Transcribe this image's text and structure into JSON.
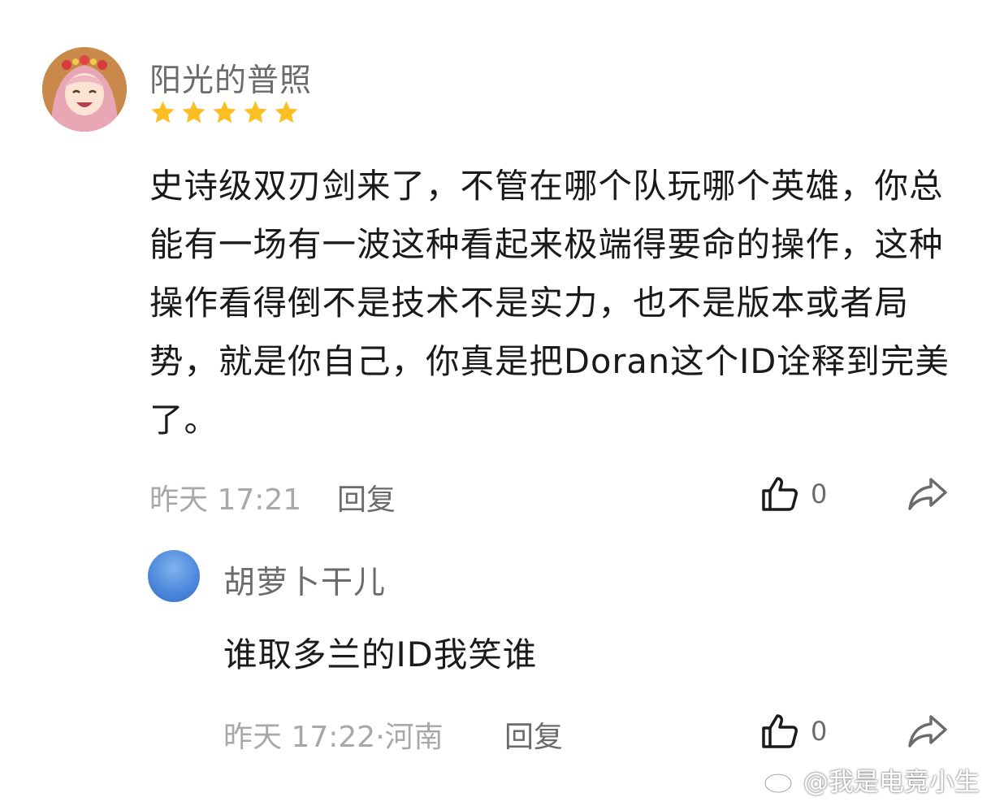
{
  "comment": {
    "username": "阳光的普照",
    "rating_stars": 5,
    "text": "史诗级双刃剑来了，不管在哪个队玩哪个英雄，你总能有一场有一波这种看起来极端得要命的操作，这种操作看得倒不是技术不是实力，也不是版本或者局势，就是你自己，你真是把Doran这个ID诠释到完美了。",
    "meta": "昨天 17:21",
    "reply_label": "回复",
    "like_count": "0"
  },
  "reply": {
    "username": "胡萝卜干儿",
    "text": "谁取多兰的ID我笑谁",
    "meta": "昨天 17:22·河南",
    "reply_label": "回复",
    "like_count": "0"
  },
  "watermark": "@我是电竞小生",
  "colors": {
    "star": "#fbbf24",
    "text_primary": "#1a1a1a",
    "text_secondary": "#6b6b6b",
    "text_muted": "#a8a8a8",
    "reply_avatar": "#4b86da"
  },
  "icons": {
    "like": "thumbs-up-icon",
    "share": "share-arrow-icon",
    "watermark": "weibo-logo-icon"
  }
}
